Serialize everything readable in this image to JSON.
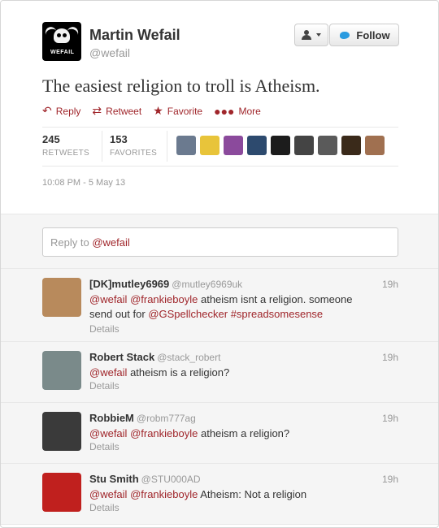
{
  "tweet": {
    "author_name": "Martin Wefail",
    "author_handle": "@wefail",
    "avatar_tag": "WEFAIL",
    "text": "The easiest religion to troll is Atheism.",
    "follow_label": "Follow",
    "actions": {
      "reply": "Reply",
      "retweet": "Retweet",
      "favorite": "Favorite",
      "more": "More"
    },
    "retweets_count": "245",
    "retweets_label": "RETWEETS",
    "favorites_count": "153",
    "favorites_label": "FAVORITES",
    "timestamp": "10:08 PM - 5 May 13"
  },
  "favoriter_colors": [
    "#6b7a8f",
    "#e8c43a",
    "#8b4a9c",
    "#2d4a6e",
    "#1c1c1c",
    "#444444",
    "#5a5a5a",
    "#3a2a1a",
    "#a07050"
  ],
  "reply_box": {
    "prefix": "Reply to ",
    "mention": "@wefail"
  },
  "replies": [
    {
      "name": "[DK]mutley6969",
      "handle": "@mutley6969uk",
      "time": "19h",
      "line1": "@wefail @frankieboyle atheism isnt a religion. someone",
      "line2": "send out for @GSpellchecker #spreadsomesense",
      "details": "Details",
      "avatar_color": "#b88a5c"
    },
    {
      "name": "Robert Stack",
      "handle": "@stack_robert",
      "time": "19h",
      "line1": "@wefail  atheism is a religion?",
      "line2": "",
      "details": "Details",
      "avatar_color": "#7a8a8a"
    },
    {
      "name": "RobbieM",
      "handle": "@robm777ag",
      "time": "19h",
      "line1": "@wefail @frankieboyle atheism a religion?",
      "line2": "",
      "details": "Details",
      "avatar_color": "#3a3a3a"
    },
    {
      "name": "Stu Smith",
      "handle": "@STU000AD",
      "time": "19h",
      "line1": "@wefail @frankieboyle Atheism: Not a religion",
      "line2": "",
      "details": "Details",
      "avatar_color": "#c0201e"
    }
  ]
}
